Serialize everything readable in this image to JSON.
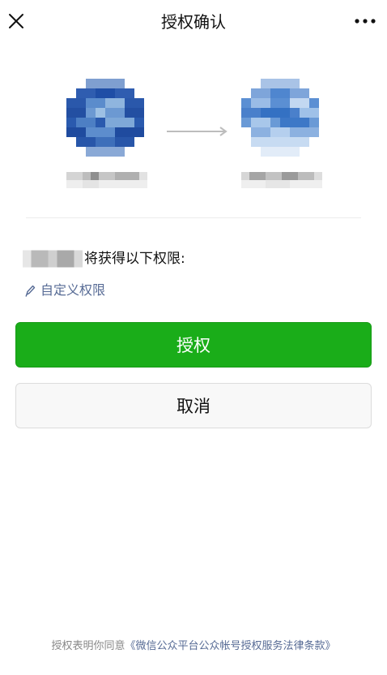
{
  "header": {
    "title": "授权确认",
    "close_icon": "close-icon",
    "more_icon": "more-dots-icon"
  },
  "authorization": {
    "arrow_icon": "arrow-right-icon",
    "permissions_text": "将获得以下权限:",
    "custom_permissions_label": "自定义权限",
    "custom_permissions_icon": "pencil-icon"
  },
  "buttons": {
    "authorize_label": "授权",
    "cancel_label": "取消"
  },
  "footer": {
    "prefix_text": "授权表明你同意",
    "terms_link": "《微信公众平台公众帐号授权服务法律条款》"
  },
  "colors": {
    "primary_green": "#1aad19",
    "link_blue": "#576b95",
    "text_gray": "#888888"
  }
}
